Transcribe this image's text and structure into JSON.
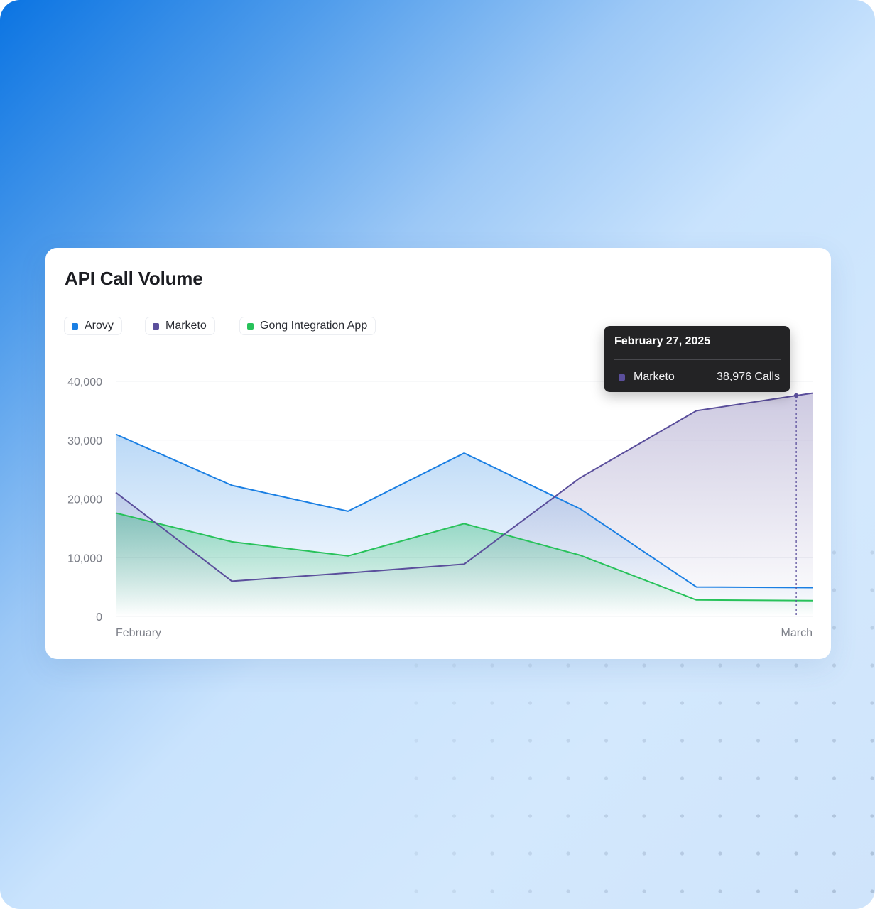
{
  "card": {
    "title": "API Call Volume"
  },
  "legend": [
    {
      "label": "Arovy",
      "color": "#1a7fe3"
    },
    {
      "label": "Marketo",
      "color": "#5b4f9c"
    },
    {
      "label": "Gong Integration App",
      "color": "#27c25a"
    }
  ],
  "tooltip": {
    "date": "February 27, 2025",
    "series": "Marketo",
    "value": "38,976 Calls",
    "color": "#5b4f9c"
  },
  "chart_data": {
    "type": "area",
    "title": "API Call Volume",
    "xlabel": "",
    "ylabel": "",
    "x_tick_labels": [
      "February",
      "March"
    ],
    "y_ticks": [
      {
        "value": 0,
        "label": "0"
      },
      {
        "value": 10000,
        "label": "10,000"
      },
      {
        "value": 20000,
        "label": "20,000"
      },
      {
        "value": 30000,
        "label": "30,000"
      },
      {
        "value": 40000,
        "label": "40,000"
      }
    ],
    "ylim": [
      0,
      40000
    ],
    "xlim": [
      0,
      6
    ],
    "grid": true,
    "legend_position": "top-left",
    "hover_index": 5.86,
    "series": [
      {
        "name": "Gong Integration App",
        "color": "#27c25a",
        "x": [
          0,
          1,
          2,
          3,
          4,
          5,
          6
        ],
        "values": [
          17600,
          12700,
          10300,
          15800,
          10400,
          2800,
          2700
        ]
      },
      {
        "name": "Arovy",
        "color": "#1a7fe3",
        "x": [
          0,
          1,
          2,
          3,
          4,
          5,
          6
        ],
        "values": [
          31000,
          22300,
          17900,
          27800,
          18300,
          5000,
          4900
        ]
      },
      {
        "name": "Marketo",
        "color": "#5b4f9c",
        "x": [
          0,
          1,
          2,
          3,
          4,
          5,
          6
        ],
        "values": [
          21100,
          6000,
          7400,
          8900,
          23600,
          35000,
          38000
        ]
      }
    ]
  }
}
